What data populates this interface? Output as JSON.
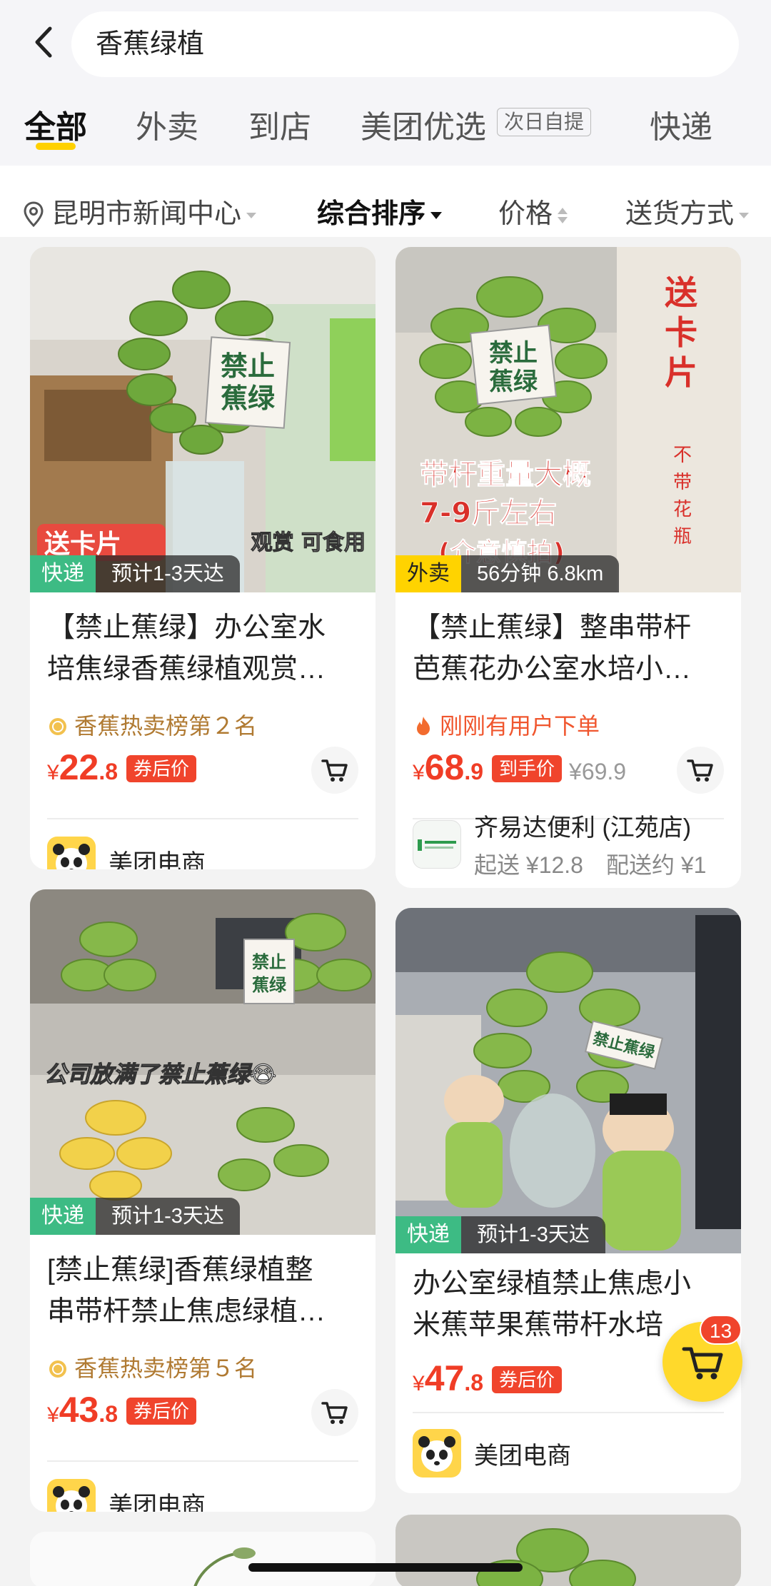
{
  "search": {
    "query": "香蕉绿植"
  },
  "tabs": [
    {
      "label": "全部",
      "active": true
    },
    {
      "label": "外卖"
    },
    {
      "label": "到店"
    },
    {
      "label": "美团优选",
      "tag": "次日自提"
    },
    {
      "label": "快递"
    }
  ],
  "filters": [
    {
      "label": "昆明市新闻中心"
    },
    {
      "label": "综合排序"
    },
    {
      "label": "价格"
    },
    {
      "label": "送货方式"
    }
  ],
  "products": [
    {
      "delivery_type": "快递",
      "delivery_text": "预计1-3天达",
      "title_line1": "【禁止蕉绿】办公室水",
      "title_line2": "培焦绿香蕉绿植观赏…",
      "rank": "香蕉热卖榜第２名",
      "price_currency": "¥",
      "price_int": "22",
      "price_dec": ".8",
      "price_tag": "券后价",
      "shop_name": "美团电商",
      "photo_sign": [
        "禁止",
        "蕉绿"
      ],
      "photo_text1": "送卡片",
      "photo_text2": "观赏 可食用"
    },
    {
      "delivery_type": "外卖",
      "delivery_text": "56分钟 6.8km",
      "title_line1": "【禁止蕉绿】整串带杆",
      "title_line2": "芭蕉花办公室水培小…",
      "rank": "刚刚有用户下单",
      "price_currency": "¥",
      "price_int": "68",
      "price_dec": ".9",
      "price_tag": "到手价",
      "price_original": "¥69.9",
      "shop_name": "齐易达便利 (江苑店)",
      "shop_sub": "起送 ¥12.8　配送约 ¥1",
      "photo_sign": [
        "禁止",
        "蕉绿"
      ],
      "photo_side": [
        "送",
        "卡",
        "片"
      ],
      "photo_side2": [
        "不",
        "带",
        "花",
        "瓶"
      ],
      "photo_text1": "带杆重量大概",
      "photo_text2": "7-9斤左右",
      "photo_text3": "(介意慎拍)"
    },
    {
      "delivery_type": "快递",
      "delivery_text": "预计1-3天达",
      "title_line1": "[禁止蕉绿]香蕉绿植整",
      "title_line2": "串带杆禁止焦虑绿植…",
      "rank": "香蕉热卖榜第５名",
      "price_currency": "¥",
      "price_int": "43",
      "price_dec": ".8",
      "price_tag": "券后价",
      "shop_name": "美团电商",
      "photo_sign": [
        "禁止",
        "蕉绿"
      ],
      "photo_caption": "公司放满了禁止蕉绿😭"
    },
    {
      "delivery_type": "快递",
      "delivery_text": "预计1-3天达",
      "title_line1": "办公室绿植禁止焦虑小",
      "title_line2": "米蕉苹果蕉带杆水培",
      "price_currency": "¥",
      "price_int": "47",
      "price_dec": ".8",
      "price_tag": "券后价",
      "shop_name": "美团电商",
      "photo_sign": [
        "禁止蕉绿"
      ]
    }
  ],
  "cart": {
    "count": "13"
  },
  "colors": {
    "accent": "#ffd100",
    "price": "#f03d26",
    "express": "#3dbb84",
    "takeout": "#ffd300"
  }
}
